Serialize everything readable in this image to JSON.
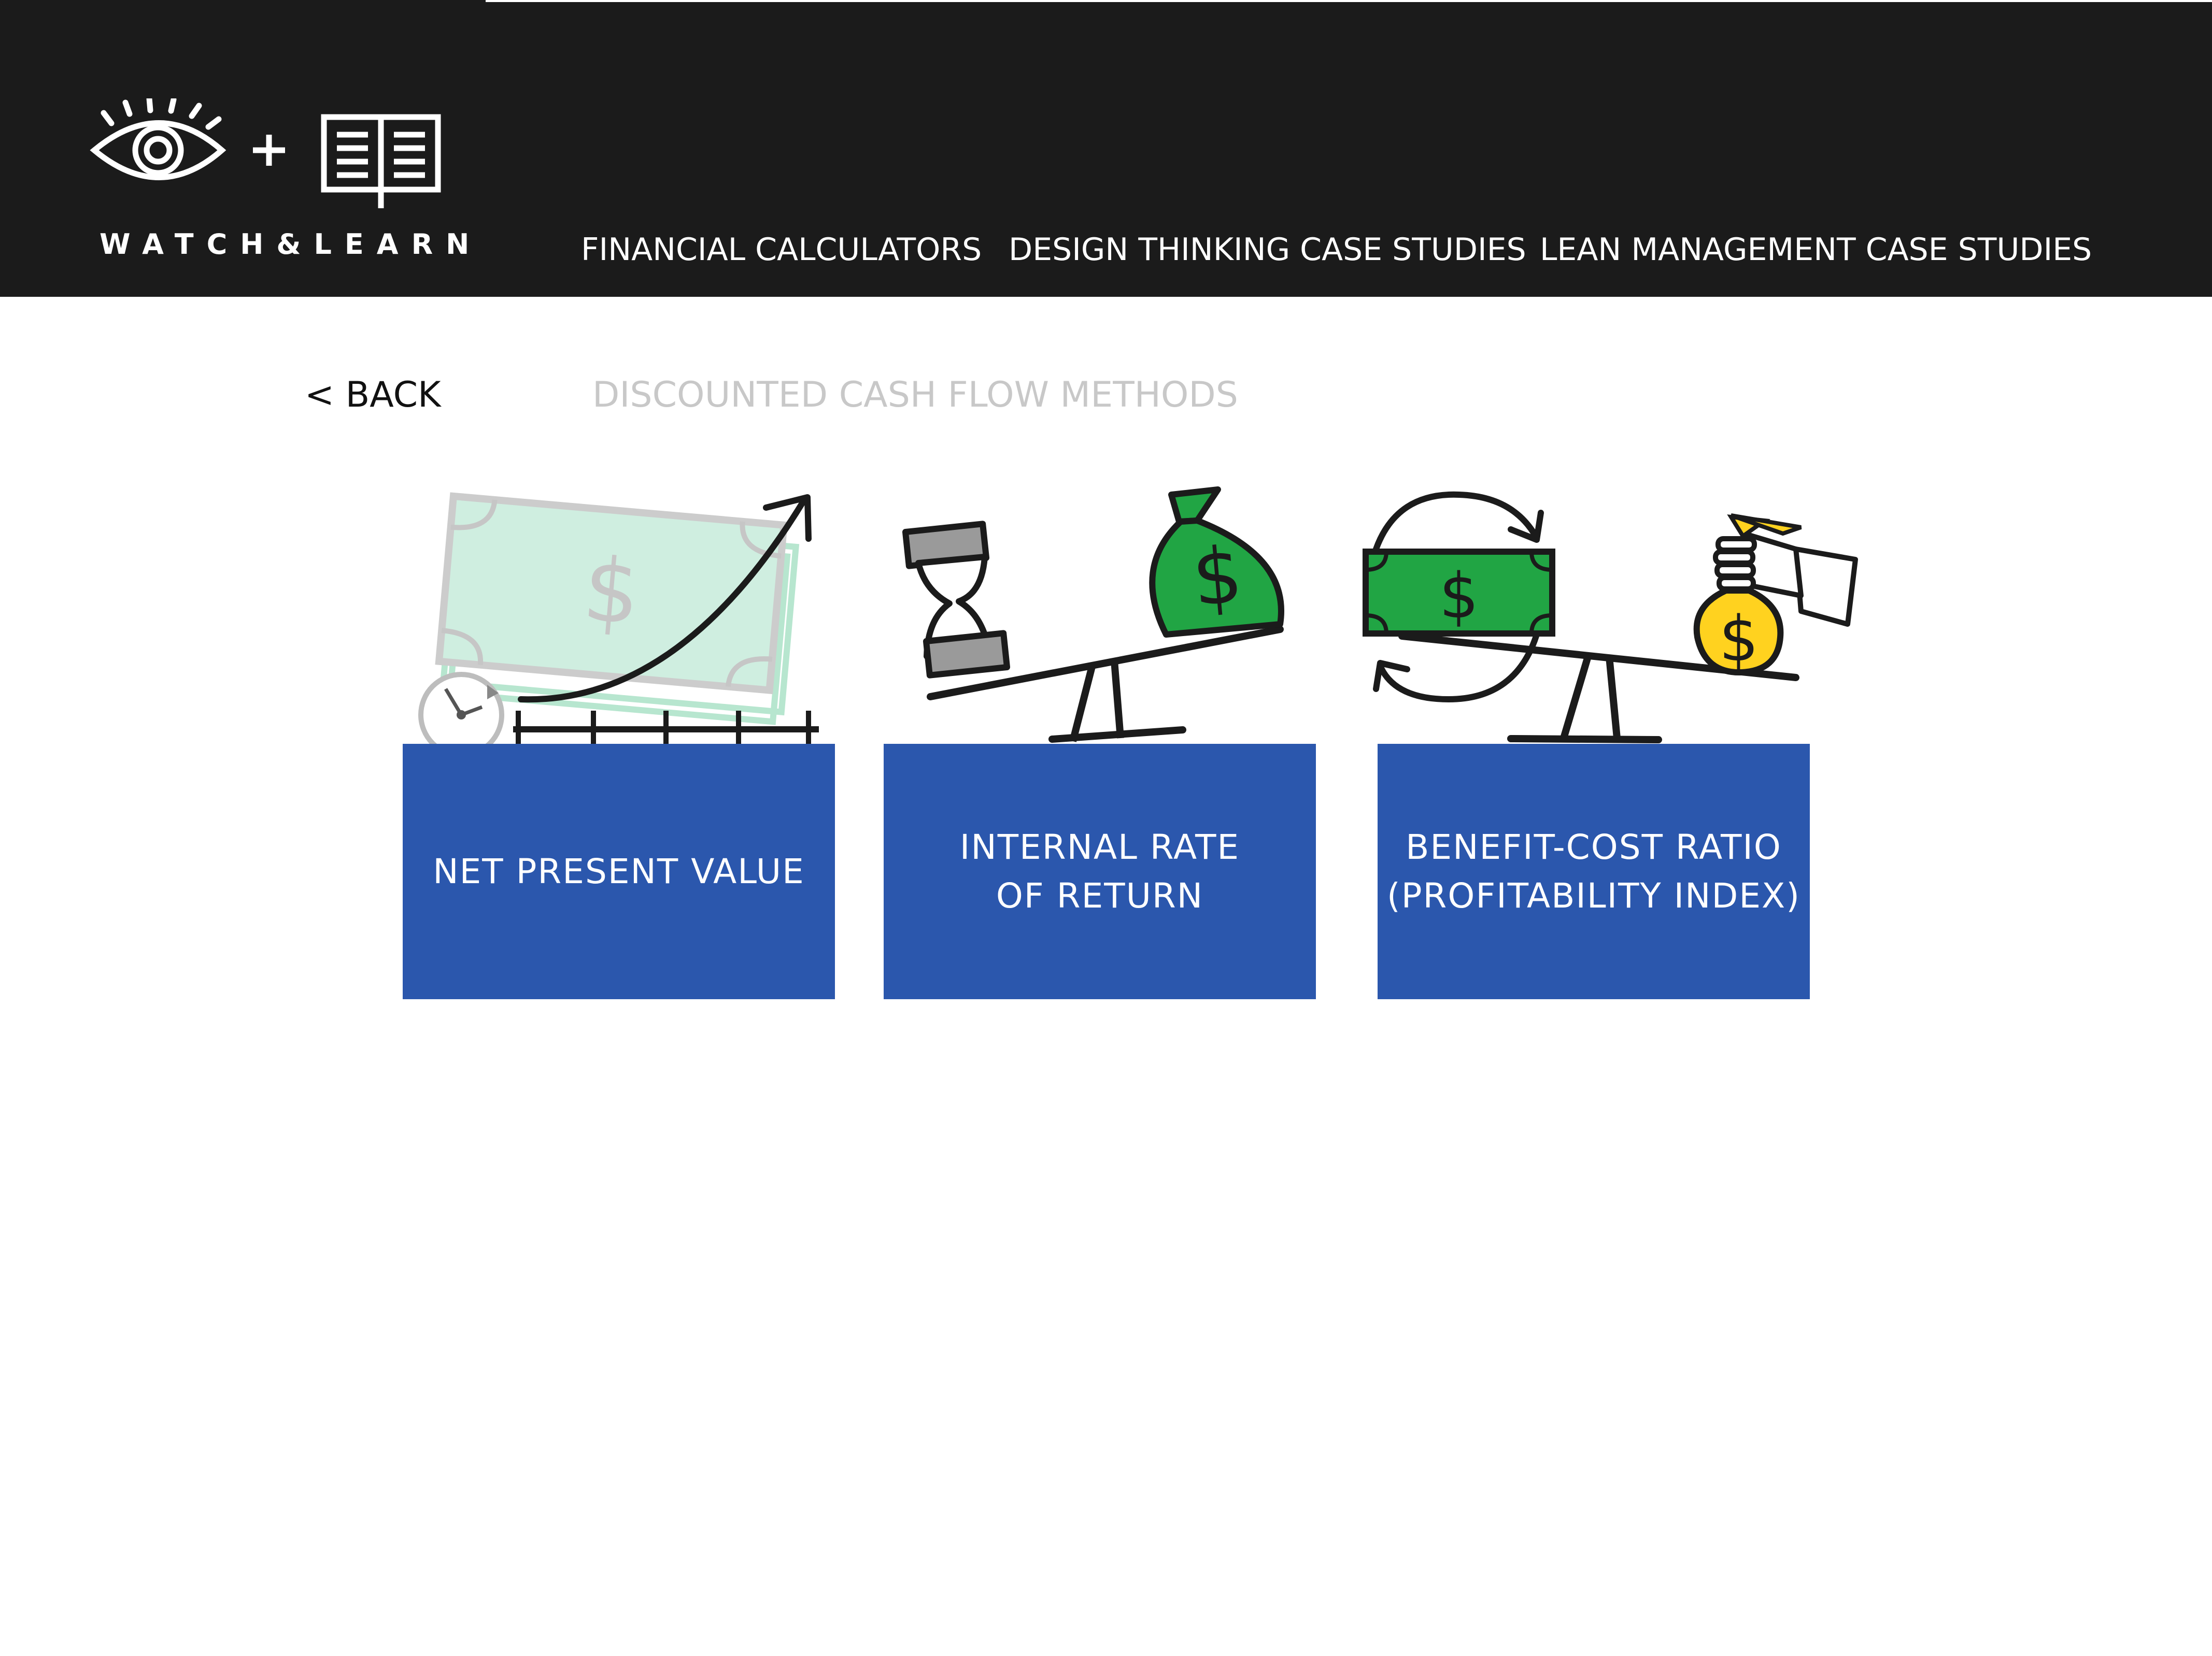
{
  "header": {
    "logo_text": "WATCH&LEARN",
    "logo_icons": [
      "eye-icon",
      "plus-icon",
      "book-icon"
    ],
    "nav": [
      {
        "label": "FINANCIAL CALCULATORS"
      },
      {
        "label": "DESIGN THINKING CASE STUDIES"
      },
      {
        "label": "LEAN MANAGEMENT CASE STUDIES"
      }
    ]
  },
  "subnav": {
    "back_label": "< BACK",
    "title": "DISCOUNTED CASH FLOW METHODS"
  },
  "cards": [
    {
      "label": "NET PRESENT VALUE",
      "icon": "money-growth-icon"
    },
    {
      "label": "INTERNAL RATE\nOF RETURN",
      "icon": "hourglass-scale-icon"
    },
    {
      "label": "BENEFIT-COST RATIO\n(PROFITABILITY INDEX)",
      "icon": "money-exchange-scale-icon"
    }
  ],
  "colors": {
    "header_bg": "#1b1b1b",
    "card_bg": "#2b57ad",
    "money_green": "#21a544",
    "light_green": "#cfeee0",
    "gold": "#ffd21f",
    "title_gray": "#c8c8c8"
  }
}
